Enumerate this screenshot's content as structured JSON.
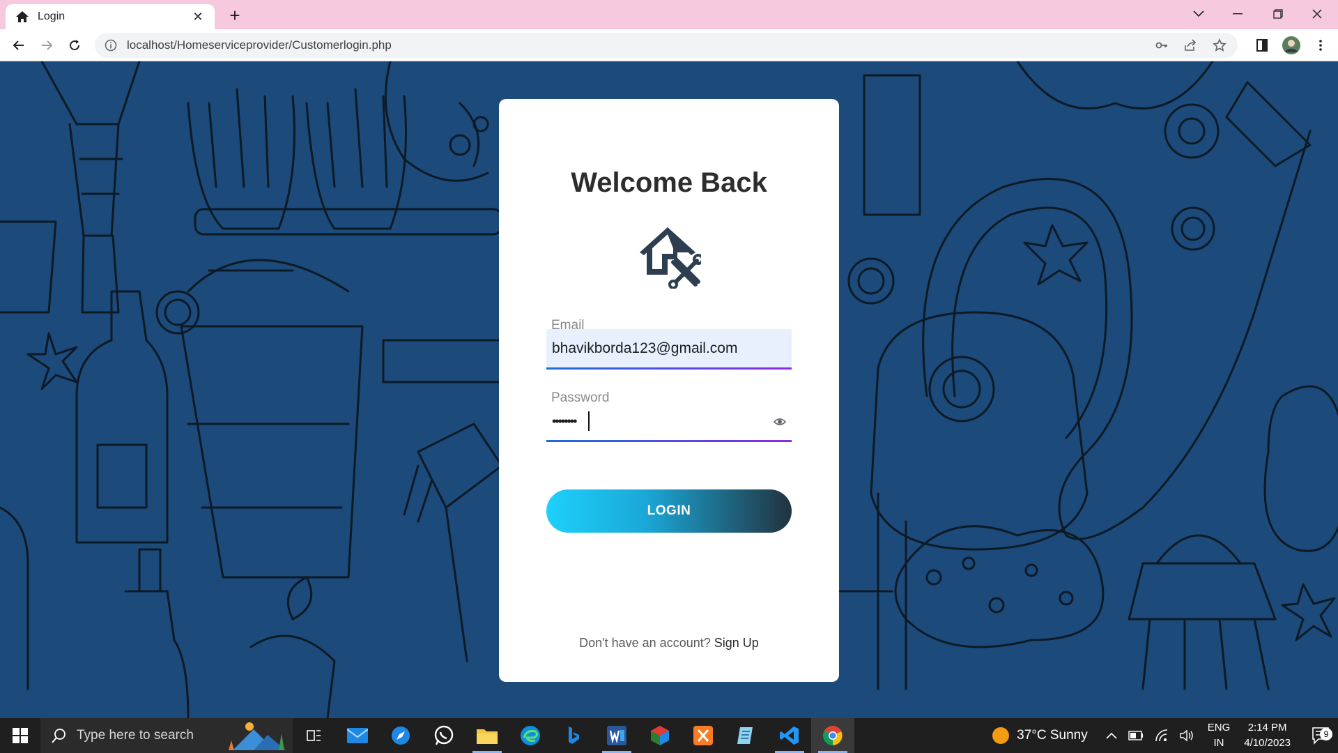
{
  "browser": {
    "tab_title": "Login",
    "url": "localhost/Homeserviceprovider/Customerlogin.php",
    "new_tab_symbol": "+",
    "close_tab_symbol": "✕"
  },
  "card": {
    "title": "Welcome Back",
    "logo_icon": "home-repair-icon",
    "email_label": "Email",
    "email_value": "bhavikborda123@gmail.com",
    "password_label": "Password",
    "password_value": "••••••••",
    "login_button": "LOGIN",
    "signup_prompt": "Don't have an account?",
    "signup_link": "Sign Up"
  },
  "taskbar": {
    "search_placeholder": "Type here to search",
    "weather": "37°C  Sunny",
    "language_line1": "ENG",
    "language_line2": "IN",
    "time": "2:14 PM",
    "date": "4/10/2023",
    "notification_count": "9"
  },
  "colors": {
    "page_background": "#1c4a7a",
    "tabbar": "#f6c9de",
    "button_gradient_start": "#1ed0fb",
    "button_gradient_end": "#21333f"
  }
}
